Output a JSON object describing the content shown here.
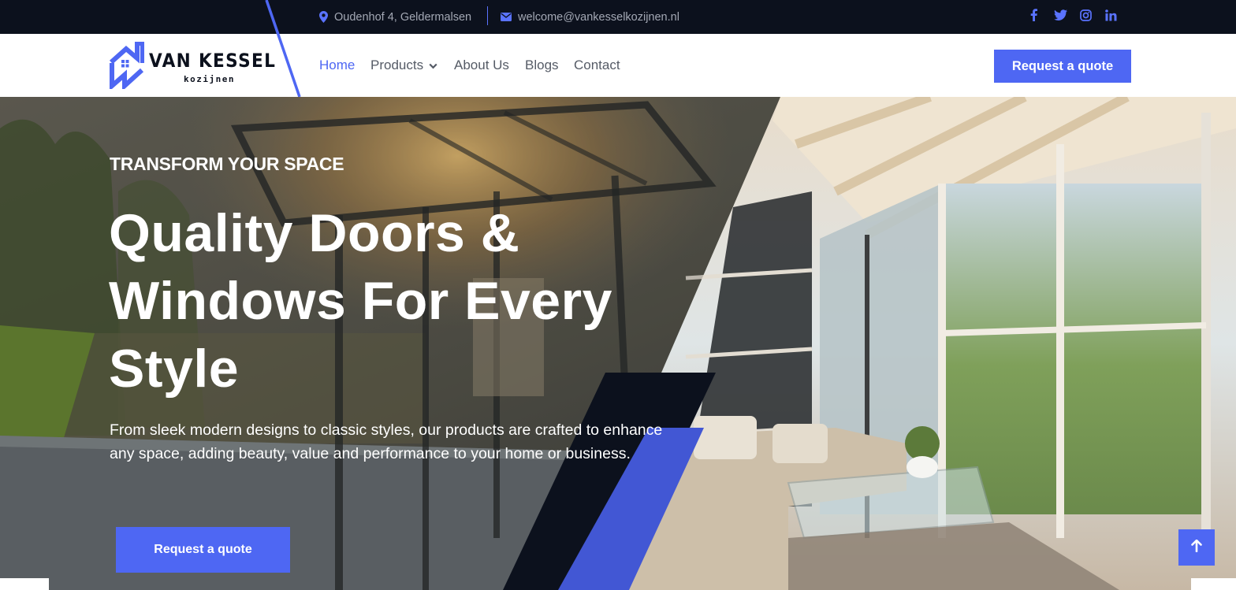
{
  "topbar": {
    "address": "Oudenhof 4, Geldermalsen",
    "email": "welcome@vankesselkozijnen.nl",
    "address_icon": "map-pin-icon",
    "email_icon": "envelope-icon",
    "social": [
      "facebook-icon",
      "twitter-icon",
      "instagram-icon",
      "linkedin-icon"
    ]
  },
  "brand": {
    "name": "VAN KESSEL",
    "tagline": "kozijnen"
  },
  "nav": {
    "home": "Home",
    "products": "Products",
    "about": "About Us",
    "blogs": "Blogs",
    "contact": "Contact",
    "active": "Home",
    "cta": "Request a quote"
  },
  "hero": {
    "eyebrow": "TRANSFORM YOUR SPACE",
    "headline": "Quality Doors & Windows For Every Style",
    "lead": "From sleek modern designs to classic styles, our products are crafted to enhance any space, adding beauty, value and performance to your home or business.",
    "cta": "Request a quote"
  },
  "colors": {
    "accent": "#4e67f3",
    "dark": "#0c111d",
    "topbar_text": "#a3a8b4",
    "nav_text": "#555b66"
  }
}
